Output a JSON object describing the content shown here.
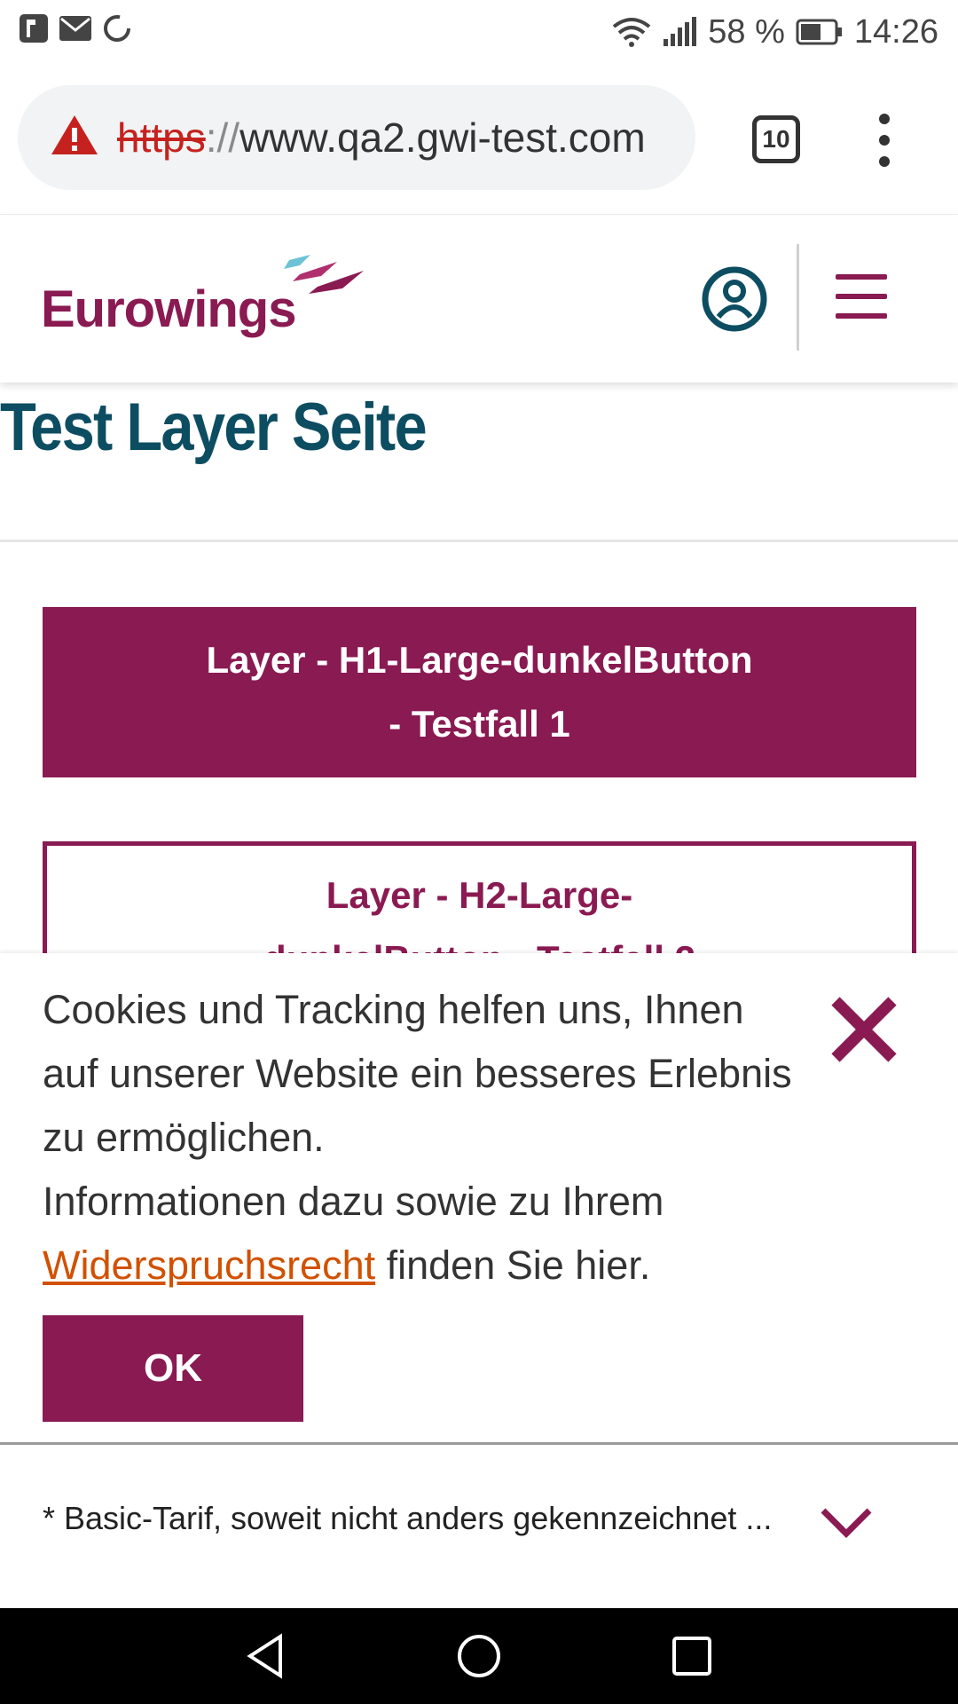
{
  "statusbar": {
    "battery": "58 %",
    "time": "14:26"
  },
  "browser": {
    "url_scheme": "https",
    "url_sep": "://",
    "url_host": "www.qa2.gwi-test.com",
    "tab_count": "10"
  },
  "site": {
    "logo_text": "Eurowings",
    "page_title": "Test Layer Seite"
  },
  "buttons": {
    "h1_label": "Layer - H1-Large-dunkelButton - Testfall 1",
    "h2_label": "Layer - H2-Large-dunkelButton - Testfall 2"
  },
  "cookie": {
    "text_main": "Cookies und Tracking helfen uns, Ihnen auf unserer Website ein besseres Erlebnis zu ermöglichen.",
    "text_info": "Informationen dazu sowie zu Ihrem",
    "link_label": "Widerspruchsrecht",
    "text_tail": " finden Sie hier.",
    "ok_label": "OK"
  },
  "footer": {
    "note": "* Basic-Tarif, soweit nicht anders gekennzeichnet ..."
  },
  "colors": {
    "brand": "#8a1a52",
    "title": "#0d4d62",
    "link": "#d15100"
  }
}
